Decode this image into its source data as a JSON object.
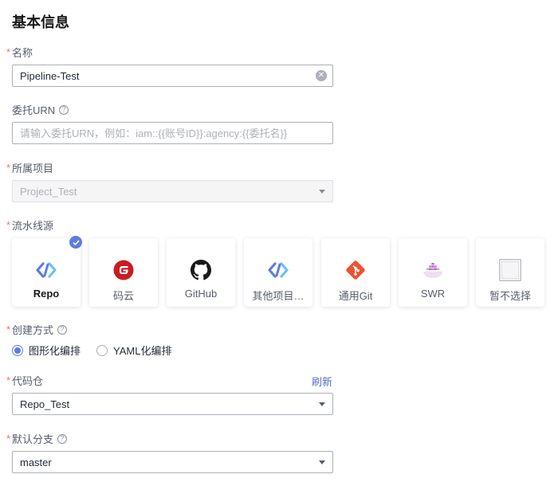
{
  "section": {
    "title": "基本信息"
  },
  "name_field": {
    "label": "名称",
    "value": "Pipeline-Test"
  },
  "urn_field": {
    "label": "委托URN",
    "placeholder": "请输入委托URN，例如：iam::{{账号ID}}:agency:{{委托名}}"
  },
  "project_field": {
    "label": "所属项目",
    "value": "Project_Test"
  },
  "source": {
    "label": "流水线源",
    "cards": [
      {
        "name": "Repo",
        "icon": "repo-icon",
        "selected": true
      },
      {
        "name": "码云",
        "icon": "gitee-icon"
      },
      {
        "name": "GitHub",
        "icon": "github-icon"
      },
      {
        "name": "其他项目…",
        "icon": "other-project-icon"
      },
      {
        "name": "通用Git",
        "icon": "git-icon"
      },
      {
        "name": "SWR",
        "icon": "swr-icon"
      },
      {
        "name": "暂不选择",
        "icon": "none-icon"
      }
    ]
  },
  "create_mode": {
    "label": "创建方式",
    "options": [
      "图形化编排",
      "YAML化编排"
    ],
    "selected": "图形化编排"
  },
  "repo_field": {
    "label": "代码仓",
    "refresh": "刷新",
    "value": "Repo_Test"
  },
  "branch_field": {
    "label": "默认分支",
    "value": "master"
  },
  "colors": {
    "accent": "#5e7ce0",
    "required": "#f66f6a",
    "link": "#526ecc",
    "gitee": "#c71d23",
    "git": "#f05133",
    "swr": "#b36bc8"
  }
}
